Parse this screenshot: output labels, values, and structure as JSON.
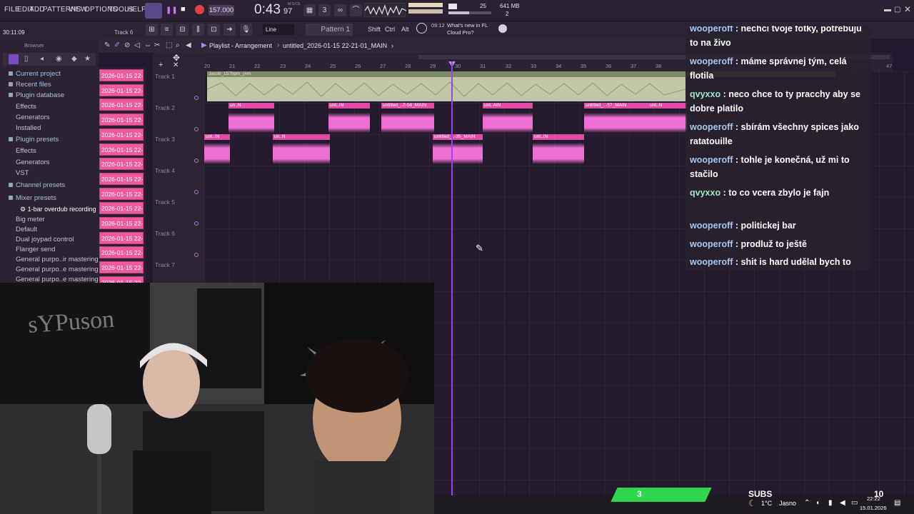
{
  "menu": [
    "FILE",
    "EDIT",
    "ADD",
    "PATTERNS",
    "VIEW",
    "OPTIONS",
    "TOOLS",
    "HELP"
  ],
  "transport": {
    "tempo": "157.000",
    "time": "0:43",
    "time_frac": "97",
    "time_unit": "M:S:CS",
    "cpu_value": "25",
    "mem": "641 MB",
    "cpu_small": "2"
  },
  "info": {
    "position": "30:11:09",
    "track_hint": "Track 6",
    "snap": "Line",
    "pattern": "Pattern 1",
    "shift": "Shift",
    "ctrl": "Ctrl",
    "alt": "Alt",
    "news_time": "09:12",
    "news_text": "What's new in FL Cloud Pro?"
  },
  "browser": {
    "title": "Browser",
    "items": [
      {
        "label": "Current project",
        "kind": "head"
      },
      {
        "label": "Recent files",
        "kind": "head"
      },
      {
        "label": "Plugin database",
        "kind": "head"
      },
      {
        "label": "Effects",
        "kind": "sub"
      },
      {
        "label": "Generators",
        "kind": "sub"
      },
      {
        "label": "Installed",
        "kind": "sub"
      },
      {
        "label": "Plugin presets",
        "kind": "head"
      },
      {
        "label": "Effects",
        "kind": "sub"
      },
      {
        "label": "Generators",
        "kind": "sub"
      },
      {
        "label": "VST",
        "kind": "sub"
      },
      {
        "label": "Channel presets",
        "kind": "head"
      },
      {
        "label": "Mixer presets",
        "kind": "head"
      },
      {
        "label": "1-bar overdub recording",
        "kind": "sel"
      },
      {
        "label": "Big meter",
        "kind": "sub"
      },
      {
        "label": "Default",
        "kind": "sub"
      },
      {
        "label": "Dual joypad control",
        "kind": "sub"
      },
      {
        "label": "Flanger send",
        "kind": "sub"
      },
      {
        "label": "General purpo..ir mastering",
        "kind": "sub"
      },
      {
        "label": "General purpo..e mastering 2",
        "kind": "sub"
      },
      {
        "label": "General purpo..e mastering 3",
        "kind": "sub"
      }
    ]
  },
  "patterns": [
    "2026-01-15 22-",
    "2026-01-15 22-",
    "2026-01-15 22-",
    "2026-01-15 22-",
    "2026-01-15 22-",
    "2026-01-15 22-",
    "2026-01-15 22-",
    "2026-01-15 22-",
    "2026-01-15 22-",
    "2026-01-15 22-",
    "2026-01-15 22-",
    "2026-01-15 22-",
    "2026-01-15 22-",
    "2026-01-15 22-",
    "2026-01-15 22-"
  ],
  "playlist": {
    "title": "Playlist - Arrangement",
    "name": "untitled_2026-01-15 22-21-01_MAIN",
    "ruler": [
      "20",
      "21",
      "22",
      "23",
      "24",
      "25",
      "26",
      "27",
      "28",
      "29",
      "30",
      "31",
      "32",
      "33",
      "34",
      "35",
      "36",
      "37",
      "38",
      "47"
    ],
    "tracks": [
      "Track 1",
      "Track 2",
      "Track 3",
      "Track 4",
      "Track 5",
      "Track 6",
      "Track 7"
    ],
    "track1_clip": "Jacob_157bpm_(#m",
    "track2_clips": [
      "un..N",
      "unt..IN",
      "un..N",
      "untitled_..7-56_MAIN",
      "unt..AIN",
      "untitled_..-57_MAIN",
      "unt..N"
    ],
    "track3_clips": [
      "unt..IN",
      "un..N",
      "untitled_..-35_MAIN",
      "unt..IN",
      "unt..IN"
    ]
  },
  "chat": [
    {
      "user": "wooperoff",
      "text": "nechci tvoje fotky, potřebuju to na živo"
    },
    {
      "user": "wooperoff",
      "text": "máme správnej tým, celá flotila"
    },
    {
      "user": "qvyxxo",
      "text": "neco chce to ty pracchy aby se dobre platilo"
    },
    {
      "user": "wooperoff",
      "text": "sbírám všechny spices jako ratatouille"
    },
    {
      "user": "wooperoff",
      "text": "tohle je konečná, už mi to stačilo"
    },
    {
      "user": "qvyxxo",
      "text": "to co vcera zbylo je fajn"
    },
    {
      "user": "wooperoff",
      "text": "politickej bar"
    },
    {
      "user": "wooperoff",
      "text": "prodluž to ještě"
    },
    {
      "user": "wooperoff",
      "text": "shit is hard udělal bych to delší"
    }
  ],
  "stream": {
    "subs_label": "SUBS",
    "subs_count": "3",
    "goal": "10"
  },
  "taskbar": {
    "weather": "1°C",
    "weather_text": "Jasno",
    "time": "22:22",
    "date": "15.01.2026"
  },
  "colors": {
    "accent": "#ef5a9e",
    "clip": "#f06fd4",
    "subs": "#2fd64e"
  }
}
